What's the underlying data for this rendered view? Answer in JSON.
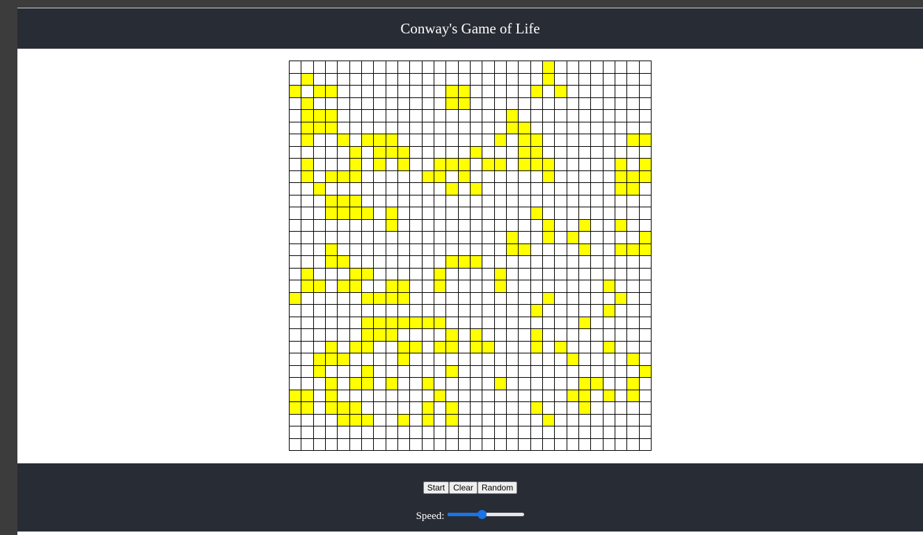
{
  "header": {
    "title": "Conway's Game of Life"
  },
  "board": {
    "rows": 32,
    "cols": 30,
    "alive_color": "#ffff00",
    "dead_color": "#ffffff",
    "grid_pattern": [
      "..........................#...",
      "...........................#..",
      "#.##..........##.........#.#....",
      ".#............##..............",
      ".###....................#.....",
      ".###....................##....",
      ".#..#.##............#.##....##",
      "....#.####.....#....##........",
      ".#..#.#.##.###.##..###....#.#",
      ".#.###.....##.#......#......##",
      "..#............#.#..........##.",
      "...###........................",
      "...####..#................#....",
      ".........#.........#...#..#...",
      "............................#..",
      "...##......................###",
      "...##.........###.............",
      ".#..##.....#....#.............",
      ".##.##.##..#....#........#...",
      "#.....####...............#....",
      "......................#....#..",
      "......####....................",
      "......###....#..#....#........",
      "...#.##.##.##.##.......#......",
      "..###...#..............#.....#",
      "..#...#........#.............#",
      "...#.##.#..#...........##.#...",
      "##.#...........#........##.#..",
      "##.###.....#..#.........#.....",
      "....###..#..#..#........#....."
    ],
    "alive": [
      [
        0,
        21
      ],
      [
        1,
        1
      ],
      [
        1,
        21
      ],
      [
        2,
        0
      ],
      [
        2,
        2
      ],
      [
        2,
        3
      ],
      [
        2,
        13
      ],
      [
        2,
        14
      ],
      [
        2,
        20
      ],
      [
        2,
        22
      ],
      [
        3,
        1
      ],
      [
        3,
        13
      ],
      [
        3,
        14
      ],
      [
        4,
        1
      ],
      [
        4,
        2
      ],
      [
        4,
        3
      ],
      [
        4,
        18
      ],
      [
        5,
        1
      ],
      [
        5,
        2
      ],
      [
        5,
        3
      ],
      [
        5,
        18
      ],
      [
        5,
        19
      ],
      [
        6,
        1
      ],
      [
        6,
        4
      ],
      [
        6,
        6
      ],
      [
        6,
        7
      ],
      [
        6,
        8
      ],
      [
        6,
        17
      ],
      [
        6,
        19
      ],
      [
        6,
        20
      ],
      [
        6,
        28
      ],
      [
        6,
        29
      ],
      [
        7,
        5
      ],
      [
        7,
        7
      ],
      [
        7,
        8
      ],
      [
        7,
        9
      ],
      [
        7,
        15
      ],
      [
        7,
        19
      ],
      [
        7,
        20
      ],
      [
        8,
        1
      ],
      [
        8,
        5
      ],
      [
        8,
        7
      ],
      [
        8,
        9
      ],
      [
        8,
        12
      ],
      [
        8,
        13
      ],
      [
        8,
        14
      ],
      [
        8,
        16
      ],
      [
        8,
        17
      ],
      [
        8,
        19
      ],
      [
        8,
        20
      ],
      [
        8,
        21
      ],
      [
        8,
        27
      ],
      [
        8,
        29
      ],
      [
        9,
        1
      ],
      [
        9,
        3
      ],
      [
        9,
        4
      ],
      [
        9,
        5
      ],
      [
        9,
        11
      ],
      [
        9,
        12
      ],
      [
        9,
        14
      ],
      [
        9,
        21
      ],
      [
        9,
        27
      ],
      [
        9,
        28
      ],
      [
        9,
        29
      ],
      [
        10,
        2
      ],
      [
        10,
        13
      ],
      [
        10,
        15
      ],
      [
        10,
        27
      ],
      [
        10,
        28
      ],
      [
        11,
        3
      ],
      [
        11,
        4
      ],
      [
        11,
        5
      ],
      [
        12,
        3
      ],
      [
        12,
        4
      ],
      [
        12,
        5
      ],
      [
        12,
        6
      ],
      [
        12,
        8
      ],
      [
        12,
        20
      ],
      [
        13,
        8
      ],
      [
        13,
        21
      ],
      [
        13,
        24
      ],
      [
        13,
        27
      ],
      [
        14,
        18
      ],
      [
        14,
        21
      ],
      [
        14,
        23
      ],
      [
        14,
        29
      ],
      [
        15,
        3
      ],
      [
        15,
        18
      ],
      [
        15,
        19
      ],
      [
        15,
        24
      ],
      [
        15,
        27
      ],
      [
        15,
        28
      ],
      [
        15,
        29
      ],
      [
        16,
        3
      ],
      [
        16,
        4
      ],
      [
        16,
        13
      ],
      [
        16,
        14
      ],
      [
        16,
        15
      ],
      [
        17,
        1
      ],
      [
        17,
        5
      ],
      [
        17,
        6
      ],
      [
        17,
        12
      ],
      [
        17,
        17
      ],
      [
        18,
        1
      ],
      [
        18,
        2
      ],
      [
        18,
        4
      ],
      [
        18,
        5
      ],
      [
        18,
        8
      ],
      [
        18,
        9
      ],
      [
        18,
        12
      ],
      [
        18,
        17
      ],
      [
        18,
        26
      ],
      [
        19,
        0
      ],
      [
        19,
        6
      ],
      [
        19,
        7
      ],
      [
        19,
        8
      ],
      [
        19,
        9
      ],
      [
        19,
        21
      ],
      [
        19,
        27
      ],
      [
        20,
        20
      ],
      [
        20,
        26
      ],
      [
        21,
        6
      ],
      [
        21,
        7
      ],
      [
        21,
        8
      ],
      [
        21,
        9
      ],
      [
        21,
        10
      ],
      [
        21,
        11
      ],
      [
        21,
        12
      ],
      [
        21,
        24
      ],
      [
        22,
        6
      ],
      [
        22,
        7
      ],
      [
        22,
        8
      ],
      [
        22,
        13
      ],
      [
        22,
        15
      ],
      [
        22,
        20
      ],
      [
        23,
        3
      ],
      [
        23,
        5
      ],
      [
        23,
        6
      ],
      [
        23,
        9
      ],
      [
        23,
        10
      ],
      [
        23,
        12
      ],
      [
        23,
        13
      ],
      [
        23,
        15
      ],
      [
        23,
        16
      ],
      [
        23,
        20
      ],
      [
        23,
        22
      ],
      [
        23,
        26
      ],
      [
        24,
        2
      ],
      [
        24,
        3
      ],
      [
        24,
        4
      ],
      [
        24,
        9
      ],
      [
        24,
        23
      ],
      [
        24,
        28
      ],
      [
        25,
        2
      ],
      [
        25,
        6
      ],
      [
        25,
        13
      ],
      [
        25,
        29
      ],
      [
        26,
        3
      ],
      [
        26,
        5
      ],
      [
        26,
        6
      ],
      [
        26,
        8
      ],
      [
        26,
        11
      ],
      [
        26,
        17
      ],
      [
        26,
        24
      ],
      [
        26,
        25
      ],
      [
        26,
        28
      ],
      [
        27,
        0
      ],
      [
        27,
        1
      ],
      [
        27,
        3
      ],
      [
        27,
        12
      ],
      [
        27,
        23
      ],
      [
        27,
        24
      ],
      [
        27,
        26
      ],
      [
        27,
        28
      ],
      [
        28,
        0
      ],
      [
        28,
        1
      ],
      [
        28,
        3
      ],
      [
        28,
        4
      ],
      [
        28,
        5
      ],
      [
        28,
        11
      ],
      [
        28,
        13
      ],
      [
        28,
        20
      ],
      [
        28,
        24
      ],
      [
        29,
        4
      ],
      [
        29,
        5
      ],
      [
        29,
        6
      ],
      [
        29,
        9
      ],
      [
        29,
        11
      ],
      [
        29,
        13
      ],
      [
        29,
        21
      ]
    ]
  },
  "controls": {
    "start_label": "Start",
    "clear_label": "Clear",
    "random_label": "Random",
    "speed_label": "Speed:",
    "speed_level": 0.45,
    "slider_color": "#1a73e8"
  }
}
